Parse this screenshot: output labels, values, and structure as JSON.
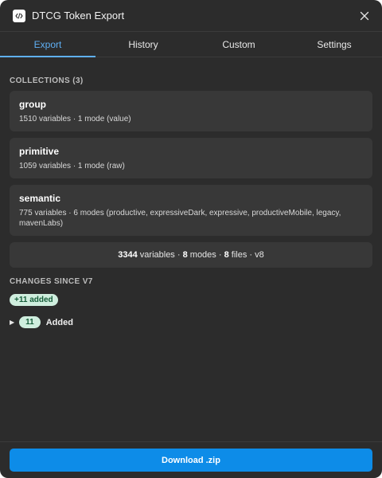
{
  "app": {
    "title": "DTCG Token Export"
  },
  "tabs": [
    {
      "label": "Export",
      "active": true
    },
    {
      "label": "History",
      "active": false
    },
    {
      "label": "Custom",
      "active": false
    },
    {
      "label": "Settings",
      "active": false
    }
  ],
  "collections": {
    "heading": "COLLECTIONS (3)",
    "items": [
      {
        "name": "group",
        "detail": "1510 variables · 1 mode (value)"
      },
      {
        "name": "primitive",
        "detail": "1059 variables · 1 mode (raw)"
      },
      {
        "name": "semantic",
        "detail": "775 variables · 6 modes (productive, expressiveDark, expressive, productiveMobile, legacy, mavenLabs)"
      }
    ]
  },
  "summary": {
    "variables_count": "3344",
    "variables_label": " variables · ",
    "modes_count": "8",
    "modes_label": " modes · ",
    "files_count": "8",
    "files_label": " files · ",
    "version": "v8"
  },
  "changes": {
    "heading": "CHANGES SINCE V7",
    "badge": "+11 added",
    "groups": [
      {
        "count": "11",
        "label": "Added",
        "expanded": false
      }
    ]
  },
  "footer": {
    "download_label": "Download .zip"
  },
  "colors": {
    "accent": "#0d8ce8",
    "tab_active": "#5fb0f5",
    "background": "#2c2c2c",
    "card": "#383838",
    "added_badge_bg": "#cfeede",
    "added_badge_text": "#155c38"
  },
  "icons": {
    "app": "code-icon",
    "close": "close-icon",
    "caret": "triangle-right-icon"
  }
}
